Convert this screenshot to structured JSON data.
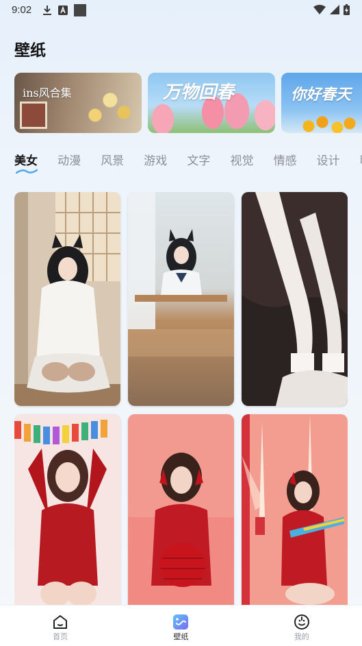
{
  "status_bar": {
    "time": "9:02",
    "left_icons": [
      "download-icon",
      "font-icon",
      "square-icon"
    ],
    "right_icons": [
      "wifi-icon",
      "signal-icon",
      "battery-icon"
    ]
  },
  "page": {
    "title": "壁纸"
  },
  "banners": [
    {
      "label": "ins风合集"
    },
    {
      "label": "万物回春"
    },
    {
      "label": "你好春天"
    }
  ],
  "tabs": [
    {
      "label": "美女",
      "active": true
    },
    {
      "label": "动漫"
    },
    {
      "label": "风景"
    },
    {
      "label": "游戏"
    },
    {
      "label": "文字"
    },
    {
      "label": "视觉"
    },
    {
      "label": "情感"
    },
    {
      "label": "设计"
    },
    {
      "label": "明星"
    }
  ],
  "colors": {
    "accent": "#4aa8f0",
    "active_tab_text": "#141414",
    "inactive_tab_text": "#8c8f95",
    "nav_inactive": "#9aa0a8"
  },
  "bottom_nav": [
    {
      "label": "首页",
      "icon": "home-icon"
    },
    {
      "label": "壁纸",
      "icon": "wallpaper-icon",
      "active": true
    },
    {
      "label": "我的",
      "icon": "profile-icon"
    }
  ]
}
